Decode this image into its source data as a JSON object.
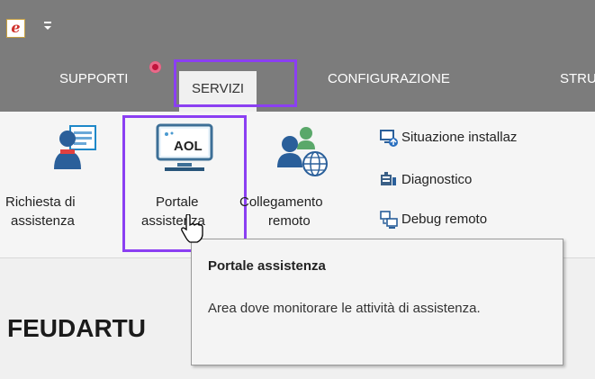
{
  "titlebar": {
    "app_icon_letter": "e",
    "quick_access_glyph": "▾"
  },
  "tabs": [
    {
      "label": "SUPPORTI",
      "active": false
    },
    {
      "label": "SERVIZI",
      "active": true
    },
    {
      "label": "CONFIGURAZIONE",
      "active": false
    },
    {
      "label": "STRU",
      "active": false
    }
  ],
  "ribbon": {
    "big_buttons": [
      {
        "line1": "Richiesta di",
        "line2": "assistenza",
        "icon": "user-document-icon"
      },
      {
        "line1": "Portale",
        "line2": "assistenza",
        "icon": "aol-portal-icon",
        "icon_text": "AOL"
      },
      {
        "line1": "Collegamento",
        "line2": "remoto",
        "icon": "remote-users-globe-icon"
      }
    ],
    "small_buttons": [
      {
        "label": "Situazione installaz",
        "icon": "installation-status-icon"
      },
      {
        "label": "Diagnostico",
        "icon": "diagnostic-icon"
      },
      {
        "label": "Debug remoto",
        "icon": "remote-debug-icon"
      }
    ]
  },
  "tooltip": {
    "title": "Portale assistenza",
    "body": "Area dove monitorare le attività di assistenza."
  },
  "content": {
    "heading": "FEUDARTU"
  },
  "colors": {
    "highlight": "#8b3ff2",
    "titlebar": "#7c7c7c",
    "badge": "#c0143c"
  }
}
